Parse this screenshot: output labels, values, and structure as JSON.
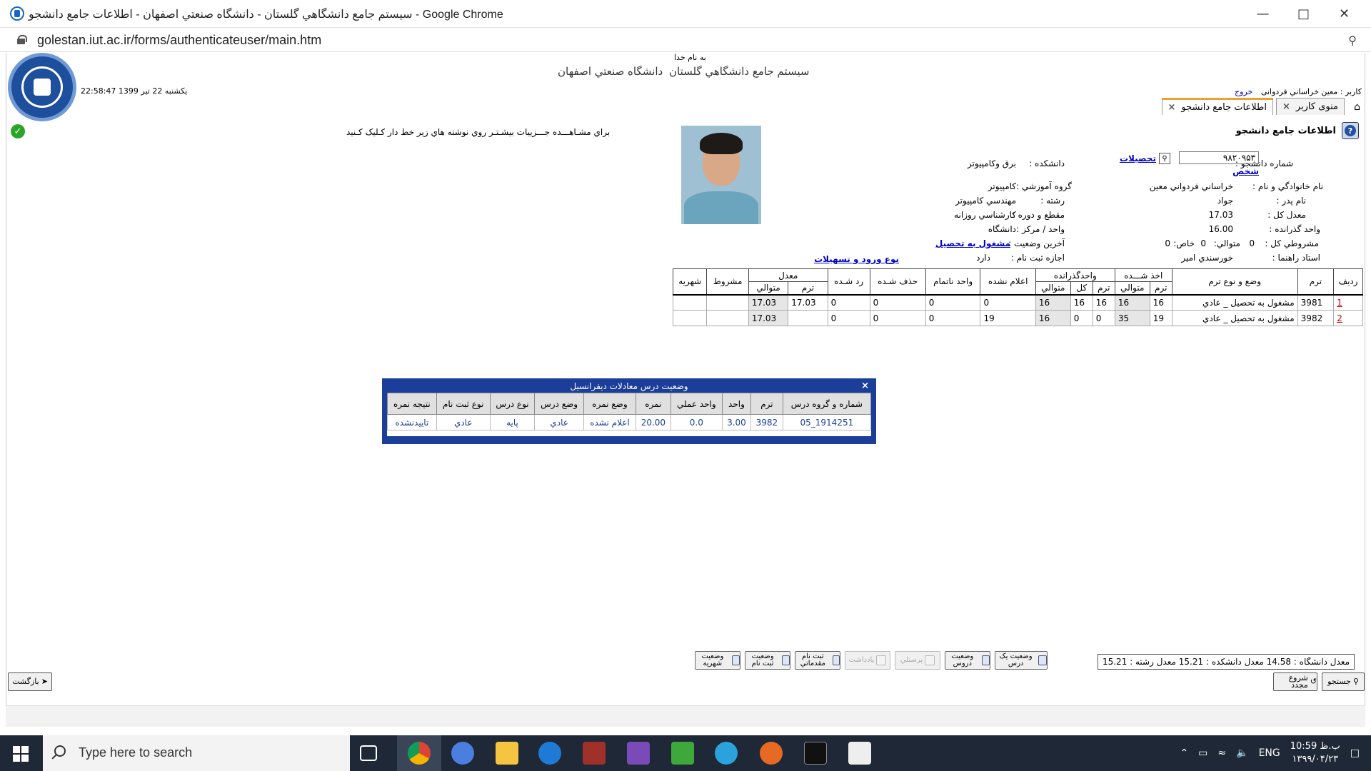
{
  "window": {
    "title": "سيستم جامع دانشگاهي گلستان - دانشگاه صنعتي اصفهان - اطلاعات جامع دانشجو - Google Chrome",
    "url": "golestan.iut.ac.ir/forms/authenticateuser/main.htm"
  },
  "header": {
    "besmellah": "به نام خدا",
    "system_title": "سيستم جامع دانشگاهي گلستان",
    "university": "دانشگاه صنعتي اصفهان",
    "datetime": "22:58:47 يکشنبه 22 تير 1399",
    "user_label": "کاربر : معين خراساني فردوانی",
    "logout": "خروج"
  },
  "tabs": [
    {
      "label": "منوی کاربر",
      "active": false
    },
    {
      "label": "اطلاعات جامع دانشجو",
      "active": true
    }
  ],
  "hint": "براي مشـاهـــده جـــزييات بيشـتـر روي نوشته هاي زير خط دار کـليک کـنيد",
  "section_title": "اطلاعات جامع دانشجو",
  "student": {
    "id_label": "شماره دانشجو :",
    "id_value": "۹۸۲۰۹۵۳",
    "link_tahsilat": "تحصیلات",
    "link_shakhs": "شخص",
    "name_label": "نام خانوادگي و نام :",
    "name_value": "خراساني فردواني معين",
    "father_label": "نام پدر :",
    "father_value": "جواد",
    "gpa_label": "معدل کل :",
    "gpa_value": "17.03",
    "passed_label": "واحد گذرانده :",
    "passed_value": "16.00",
    "probation_label": "مشروطي کل :",
    "probation_value": "0",
    "consec_label": "متوالي:",
    "consec_value": "0",
    "special_label": "خاص:",
    "special_value": "0",
    "advisor_label": "استاد راهنما :",
    "advisor_value": "خورسندي امير",
    "faculty_label": "دانشکده :",
    "faculty_value": "برق وکامپيوتر",
    "group_label": "گروه آموزشي :",
    "group_value": "کامپيوتر",
    "major_label": "رشته :",
    "major_value": "مهندسي کامپيوتر",
    "level_label": "مقطع و دوره :",
    "level_value": "کارشناسي  روزانه",
    "center_label": "واحد / مرکز :",
    "center_value": "دانشگاه",
    "status_label": "آخرين وضعيت :",
    "status_value": "مشغول به تحصيل",
    "reg_label": "اجازه ثبت نام :",
    "reg_value": "دارد",
    "entry_link": "نوع ورود و تسهيلات"
  },
  "stats_table": {
    "group_headers": {
      "taken": "اخذ شـــده",
      "passed": "واحدگذرانده",
      "gpa": "معدل"
    },
    "headers": {
      "row": "رديف",
      "term": "ترم",
      "status": "وضع و نوع ترم",
      "taken_term": "ترم",
      "taken_consec": "متوالي",
      "passed_term": "ترم",
      "passed_total": "کل",
      "passed_consec": "متوالي",
      "unannounced": "اعلام نشده",
      "incomplete": "واحد ناتمام",
      "dropped": "حذف شـده",
      "failed": "رد شـده",
      "gpa_term": "ترم",
      "gpa_consec": "متوالي",
      "probation": "مشروط",
      "tuition": "شهريه"
    },
    "rows": [
      {
        "idx": "1",
        "term": "3981",
        "status": "مشغول به تحصيل _ عادي",
        "taken_term": "16",
        "taken_consec": "16",
        "passed_term": "16",
        "passed_total": "16",
        "passed_consec": "16",
        "unannounced": "0",
        "incomplete": "0",
        "dropped": "0",
        "failed": "0",
        "gpa_term": "17.03",
        "gpa_consec": "17.03",
        "probation": "",
        "tuition": ""
      },
      {
        "idx": "2",
        "term": "3982",
        "status": "مشغول به تحصيل _ عادي",
        "taken_term": "19",
        "taken_consec": "35",
        "passed_term": "0",
        "passed_total": "0",
        "passed_consec": "16",
        "unannounced": "19",
        "incomplete": "0",
        "dropped": "0",
        "failed": "0",
        "gpa_term": "",
        "gpa_consec": "17.03",
        "probation": "",
        "tuition": ""
      }
    ]
  },
  "popup": {
    "title": "وضعيت درس معادلات ديفرانسيل",
    "close": "×",
    "headers": [
      "شماره و گروه درس",
      "ترم",
      "واحد",
      "واحد عملي",
      "نمره",
      "وضع نمره",
      "وضع درس",
      "نوع درس",
      "نوع ثبت نام",
      "نتيجه نمره"
    ],
    "row": [
      "1914251_05",
      "3982",
      "3.00",
      "0.0",
      "20.00",
      "اعلام نشده",
      "عادي",
      "پايه",
      "عادي",
      "تاييدنشده"
    ]
  },
  "bottom": {
    "averages": "معدل دانشگاه :  14.58  معدل دانشکده :  15.21  معدل رشته :  15.21",
    "buttons": [
      "وضعيت يک درس",
      "وضعيت دروس",
      "پرسنلي",
      "يادداشت",
      "ثبت نام مقدماتي",
      "وضعيت ثبت نام",
      "وضعيت شهريه"
    ],
    "search": "جستجو",
    "restart": "شروع مجدد",
    "back": "بازگشت"
  },
  "taskbar": {
    "search_placeholder": "Type here to search",
    "lang": "ENG",
    "time": "10:59 ب.ظ",
    "date": "۱۳۹۹/۰۴/۲۳"
  }
}
